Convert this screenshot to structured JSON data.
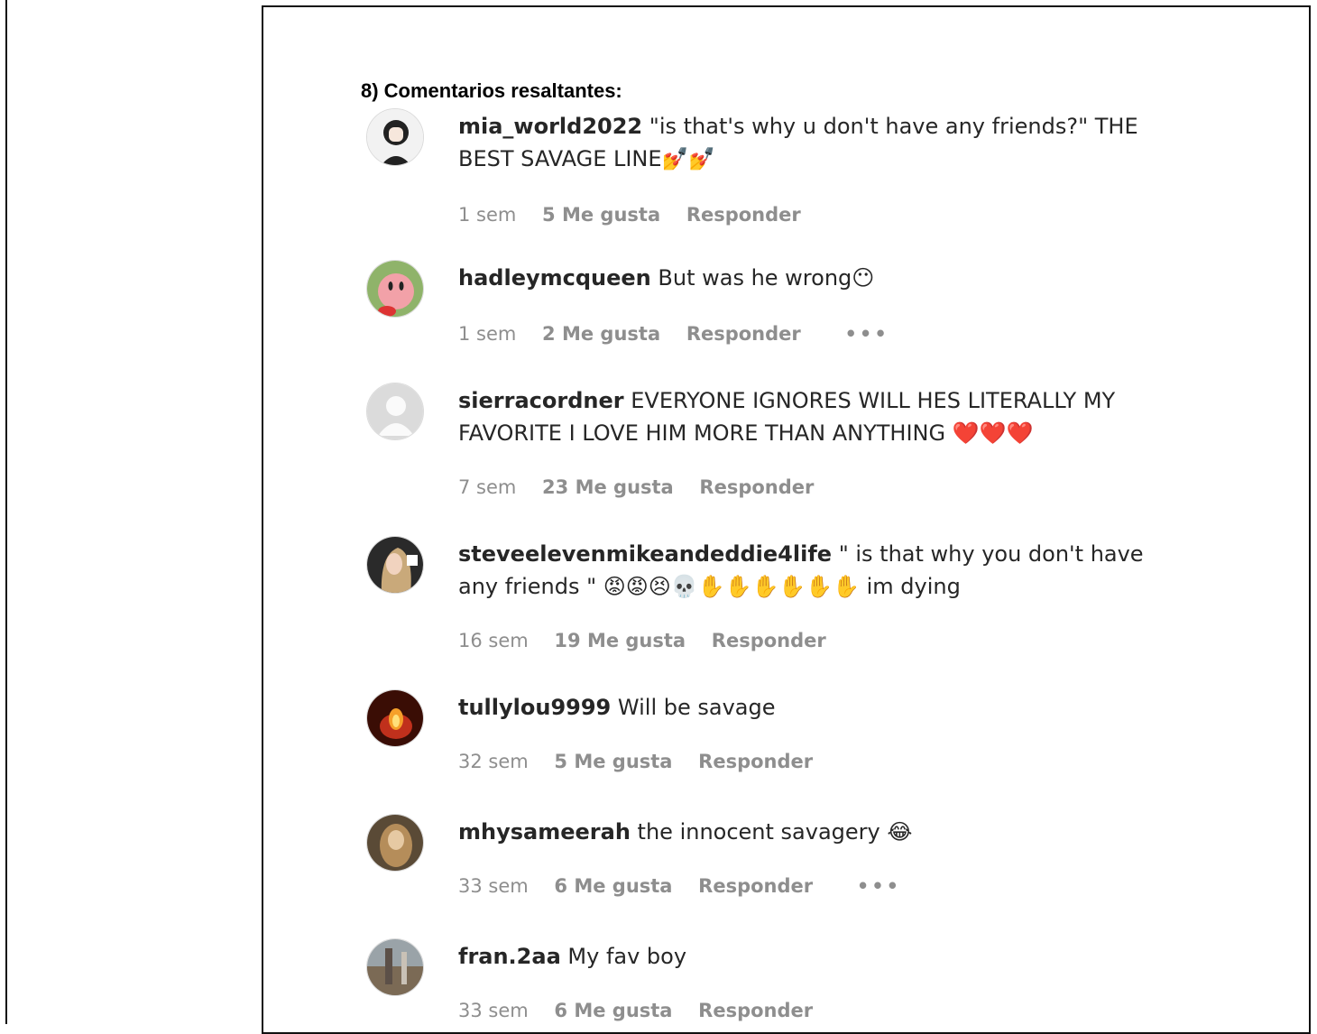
{
  "heading": "8) Comentarios resaltantes:",
  "comments": [
    {
      "username": "mia_world2022",
      "text": "\"is that's why u don't have any friends?\" THE BEST SAVAGE LINE💅💅",
      "time": "1 sem",
      "likes": "5 Me gusta",
      "reply": "Responder",
      "avatar": "anime-girl-avatar",
      "more": false
    },
    {
      "username": "hadleymcqueen",
      "text": "But was he wrong😶",
      "time": "1 sem",
      "likes": "2 Me gusta",
      "reply": "Responder",
      "avatar": "kirby-avatar",
      "more": true
    },
    {
      "username": "sierracordner",
      "text": "EVERYONE IGNORES WILL HES LITERALLY MY FAVORITE I LOVE HIM MORE THAN ANYTHING ❤️❤️❤️",
      "time": "7 sem",
      "likes": "23 Me gusta",
      "reply": "Responder",
      "avatar": "default-avatar",
      "more": false
    },
    {
      "username": "steveelevenmikeandeddie4life",
      "text": "\" is that why you don't have any friends \" 😡😡😣💀✋✋✋✋✋✋ im dying",
      "time": "16 sem",
      "likes": "19 Me gusta",
      "reply": "Responder",
      "avatar": "girl-photo-avatar",
      "more": false
    },
    {
      "username": "tullylou9999",
      "text": "Will be savage",
      "time": "32 sem",
      "likes": "5 Me gusta",
      "reply": "Responder",
      "avatar": "fire-avatar",
      "more": false
    },
    {
      "username": "mhysameerah",
      "text": "the innocent savagery 😂",
      "time": "33 sem",
      "likes": "6 Me gusta",
      "reply": "Responder",
      "avatar": "portrait-avatar",
      "more": true
    },
    {
      "username": "fran.2aa",
      "text": "My fav boy",
      "time": "33 sem",
      "likes": "6 Me gusta",
      "reply": "Responder",
      "avatar": "landscape-avatar",
      "more": false
    }
  ],
  "colors": {
    "text": "#262626",
    "meta": "#8e8e8e",
    "border": "#111111"
  }
}
